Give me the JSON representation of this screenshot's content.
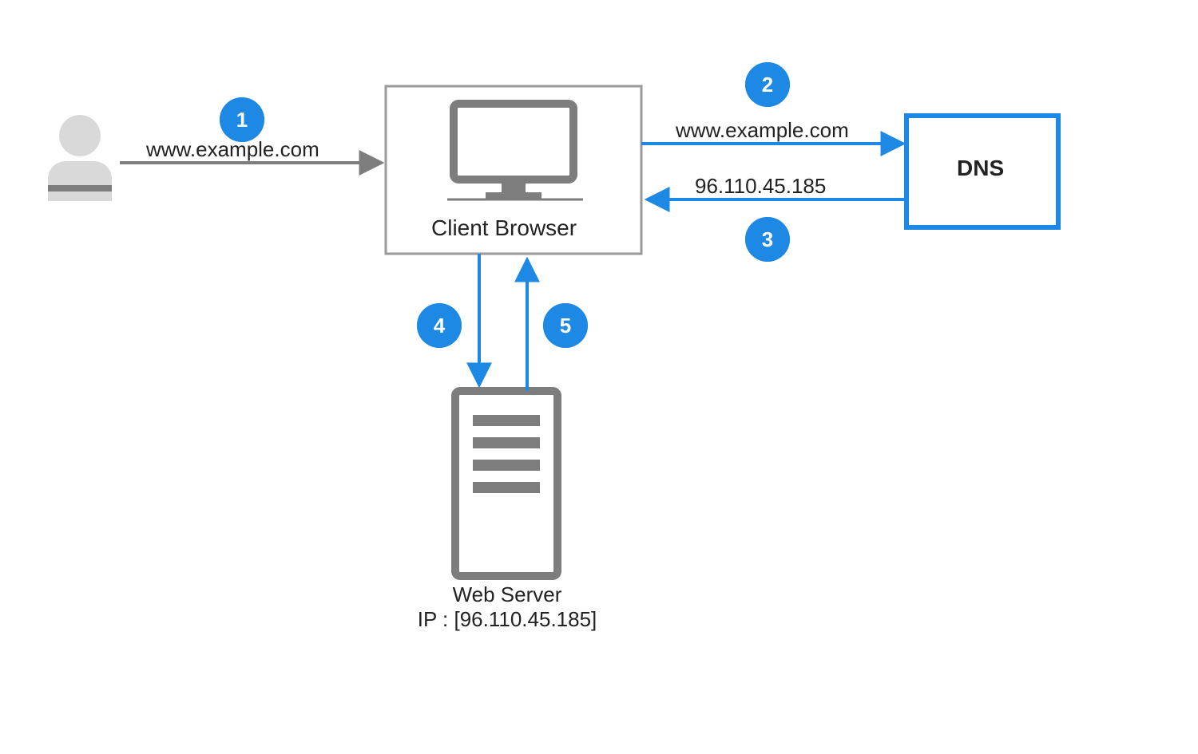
{
  "nodes": {
    "client_browser": "Client Browser",
    "dns": "DNS",
    "web_server": "Web Server",
    "web_server_ip": "IP : [96.110.45.185]"
  },
  "arrows": {
    "user_to_browser": "www.example.com",
    "browser_to_dns": "www.example.com",
    "dns_to_browser": "96.110.45.185"
  },
  "steps": {
    "s1": "1",
    "s2": "2",
    "s3": "3",
    "s4": "4",
    "s5": "5"
  },
  "colors": {
    "accent": "#1e88e5",
    "gray": "#7d7d7d"
  }
}
